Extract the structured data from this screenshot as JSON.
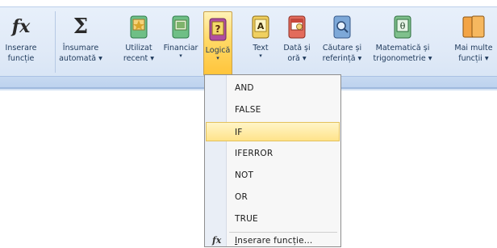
{
  "ribbon": {
    "buttons": [
      {
        "id": "insert-function",
        "line1": "Inserare",
        "line2": "funcție",
        "arrow": ""
      },
      {
        "id": "autosum",
        "line1": "Însumare",
        "line2": "automată ▾",
        "arrow": ""
      },
      {
        "id": "recent",
        "line1": "Utilizat",
        "line2": "recent ▾",
        "arrow": ""
      },
      {
        "id": "financial",
        "line1": "Financiar",
        "line2": "",
        "arrow": "▾"
      },
      {
        "id": "logical",
        "line1": "Logică",
        "line2": "",
        "arrow": "▾"
      },
      {
        "id": "text",
        "line1": "Text",
        "line2": "",
        "arrow": "▾"
      },
      {
        "id": "datetime",
        "line1": "Dată și",
        "line2": "oră ▾",
        "arrow": ""
      },
      {
        "id": "lookup",
        "line1": "Căutare și",
        "line2": "referință ▾",
        "arrow": ""
      },
      {
        "id": "math",
        "line1": "Matematică și",
        "line2": "trigonometrie ▾",
        "arrow": ""
      },
      {
        "id": "more",
        "line1": "Mai multe",
        "line2": "funcții ▾",
        "arrow": ""
      }
    ],
    "icons": {
      "insert_function_glyph": "fx",
      "autosum_glyph": "Σ",
      "logical_glyph": "?",
      "text_glyph": "A",
      "math_glyph": "θ"
    }
  },
  "menu": {
    "items": [
      "AND",
      "FALSE",
      "IF",
      "IFERROR",
      "NOT",
      "OR",
      "TRUE"
    ],
    "highlighted": "IF",
    "footer_label_underlined": "I",
    "footer_label_rest": "nserare funcție...",
    "footer_icon": "fx"
  },
  "colors": {
    "highlight": "#ffe38a",
    "ribbon_bg": "#dfe9f7"
  }
}
